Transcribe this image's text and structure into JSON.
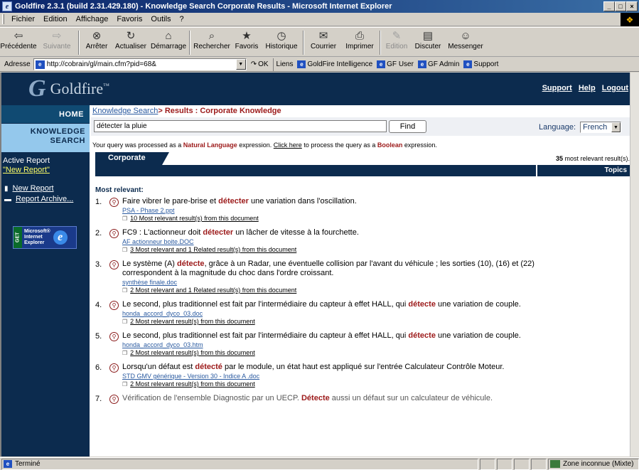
{
  "window": {
    "title": "Goldfire 2.3.1 (build 2.31.429.180) - Knowledge Search Corporate Results - Microsoft Internet Explorer",
    "minimize": "_",
    "maximize": "□",
    "close": "×"
  },
  "menu": [
    "Fichier",
    "Edition",
    "Affichage",
    "Favoris",
    "Outils",
    "?"
  ],
  "toolbar": [
    {
      "label": "Précédente",
      "icon": "back-arrow-icon",
      "glyph": "⇦",
      "disabled": false
    },
    {
      "label": "Suivante",
      "icon": "forward-arrow-icon",
      "glyph": "⇨",
      "disabled": true
    },
    {
      "label": "Arrêter",
      "icon": "stop-icon",
      "glyph": "⊗",
      "disabled": false
    },
    {
      "label": "Actualiser",
      "icon": "refresh-icon",
      "glyph": "↻",
      "disabled": false
    },
    {
      "label": "Démarrage",
      "icon": "home-icon",
      "glyph": "⌂",
      "disabled": false
    },
    {
      "label": "Rechercher",
      "icon": "search-icon",
      "glyph": "⌕",
      "disabled": false
    },
    {
      "label": "Favoris",
      "icon": "favorites-icon",
      "glyph": "★",
      "disabled": false
    },
    {
      "label": "Historique",
      "icon": "history-icon",
      "glyph": "◷",
      "disabled": false
    },
    {
      "label": "Courrier",
      "icon": "mail-icon",
      "glyph": "✉",
      "disabled": false
    },
    {
      "label": "Imprimer",
      "icon": "print-icon",
      "glyph": "⎙",
      "disabled": false
    },
    {
      "label": "Edition",
      "icon": "edit-icon",
      "glyph": "✎",
      "disabled": true
    },
    {
      "label": "Discuter",
      "icon": "discuss-icon",
      "glyph": "▤",
      "disabled": false
    },
    {
      "label": "Messenger",
      "icon": "messenger-icon",
      "glyph": "☺",
      "disabled": false
    }
  ],
  "address": {
    "label": "Adresse",
    "url": "http://cobrain/gl/main.cfm?pid=68&",
    "go": "OK",
    "links_label": "Liens",
    "links": [
      "GoldFire Intelligence",
      "GF User",
      "GF Admin",
      "Support"
    ]
  },
  "header": {
    "brand": "Goldfire",
    "tm": "™",
    "links": [
      "Support",
      "Help",
      "Logout"
    ]
  },
  "nav": {
    "home": "HOME",
    "knowledge_line1": "KNOWLEDGE",
    "knowledge_line2": "SEARCH",
    "active_report": "Active Report",
    "new_report_quoted": "\"New Report\"",
    "new_report": "New Report",
    "report_archive": "Report Archive...",
    "ie_badge_get": "GET",
    "ie_badge_line1": "Microsoft®",
    "ie_badge_line2": "Internet",
    "ie_badge_line3": "Explorer"
  },
  "breadcrumb": {
    "knowledge_search": "Knowledge Search",
    "sep": "> ",
    "current": "Results : Corporate Knowledge"
  },
  "search": {
    "query": "détecter la pluie",
    "find": "Find",
    "language_label": "Language:",
    "language_value": "French"
  },
  "query_note": {
    "pre": "Your query was processed as a ",
    "mode": "Natural Language",
    "mid": " expression. ",
    "click": "Click here",
    "post1": " to process the query as a ",
    "alt": "Boolean",
    "post2": " expression."
  },
  "tabs": {
    "corporate": "Corporate",
    "count": "35",
    "count_suffix": " most relevant result(s).",
    "topics": "Topics"
  },
  "most_relevant": "Most relevant:",
  "results": [
    {
      "num": "1.",
      "pre": "Faire vibrer le pare-brise et ",
      "hl": "détecter",
      "post": " une variation dans l'oscillation.",
      "doc": "PSA - Phase 2.ppt",
      "more": "10 Most relevant result(s) from this document"
    },
    {
      "num": "2.",
      "pre": "FC9 : L'actionneur doit ",
      "hl": "détecter",
      "post": " un lâcher de vitesse à la fourchette.",
      "doc": "AF actionneur boite.DOC",
      "more": "3 Most relevant and 1 Related result(s) from this document"
    },
    {
      "num": "3.",
      "pre": "Le système (A) ",
      "hl": "détecte",
      "post": ", grâce à un Radar, une éventuelle collision par l'avant du véhicule ; les sorties (10), (16) et (22) correspondent à la magnitude du choc dans l'ordre croissant.",
      "doc": "synthèse finale.doc",
      "more": "2 Most relevant and 1 Related result(s) from this document"
    },
    {
      "num": "4.",
      "pre": "Le second, plus traditionnel est fait par l'intermédiaire du capteur à effet HALL, qui ",
      "hl": "détecte",
      "post": " une variation de couple.",
      "doc": "honda_accord_dyco_03.doc",
      "more": "2 Most relevant result(s) from this document"
    },
    {
      "num": "5.",
      "pre": "Le second, plus traditionnel est fait par l'intermédiaire du capteur à effet HALL, qui ",
      "hl": "détecte",
      "post": " une variation de couple.",
      "doc": "honda_accord_dyco_03.htm",
      "more": "2 Most relevant result(s) from this document"
    },
    {
      "num": "6.",
      "pre": "Lorsqu'un défaut est ",
      "hl": "détecté",
      "post": " par le module, un état haut est appliqué sur l'entrée Calculateur Contrôle Moteur.",
      "doc": "STD GMV générique - Version 30 - Indice A .doc",
      "more": "2 Most relevant result(s) from this document"
    },
    {
      "num": "7.",
      "pre": "Vérification de l'ensemble Diagnostic par un UECP. ",
      "hl": "Détecte",
      "post": " aussi un défaut sur un calculateur de véhicule.",
      "doc": "",
      "more": ""
    }
  ],
  "status": {
    "text": "Terminé",
    "zone": "Zone inconnue (Mixte)"
  }
}
